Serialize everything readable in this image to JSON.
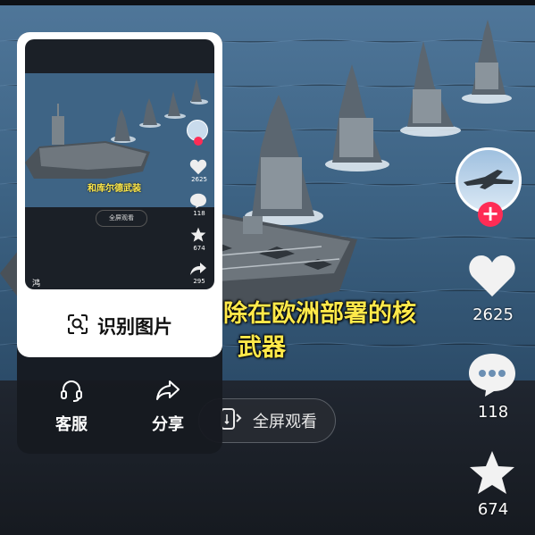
{
  "video": {
    "subtitle_line1": "除在欧洲部署的核",
    "subtitle_line2": "武器",
    "fullscreen_label": "全屏观看"
  },
  "rail": {
    "like_count": "2625",
    "comment_count": "118",
    "favorite_count": "674"
  },
  "popup": {
    "identify_label": "识别图片",
    "service_label": "客服",
    "share_label": "分享",
    "thumbnail": {
      "subtitle": "和库尔德武装",
      "fullscreen_label": "全屏观看",
      "like_count": "2625",
      "comment_count": "118",
      "favorite_count": "674",
      "share_count": "295",
      "handle_glyph": "鸿"
    }
  },
  "colors": {
    "subtitle": "#ffe94a",
    "follow_plus": "#fe2c55",
    "popup_bg": "#ffffff",
    "sea": "#3d6384"
  }
}
